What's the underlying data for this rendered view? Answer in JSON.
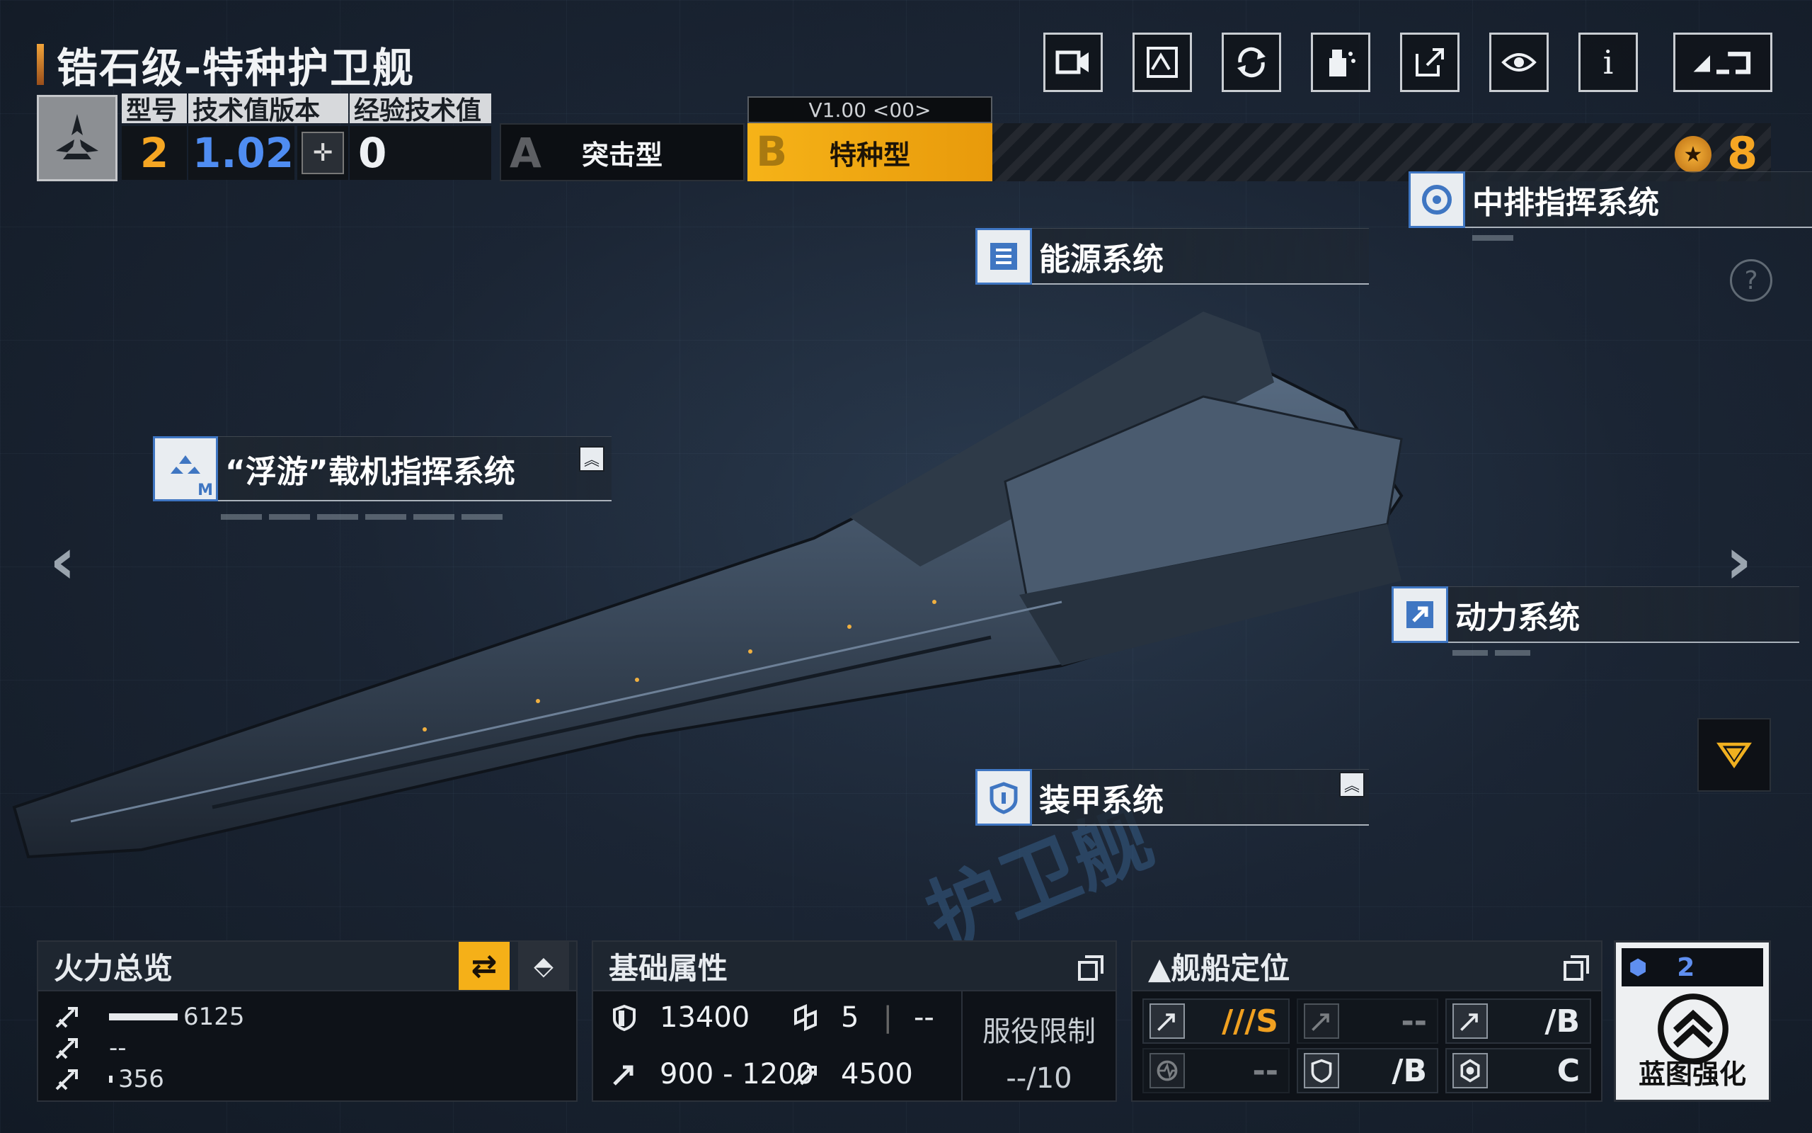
{
  "title": "锆石级-特种护卫舰",
  "stats": {
    "headers": [
      "型号",
      "技术值版本",
      "经验技术值"
    ],
    "model": "2",
    "tech_version": "1.02",
    "exp_tech": "0",
    "divider_symbol": "-|-"
  },
  "type_tabs": [
    {
      "letter": "A",
      "label": "突击型",
      "active": false
    },
    {
      "letter": "B",
      "label": "特种型",
      "active": true
    }
  ],
  "version_label": "V1.00 <00>",
  "rank": "8",
  "systems": {
    "central_command": "中排指挥系统",
    "energy": "能源系统",
    "carrier": "“浮游”载机指挥系统",
    "carrier_badge": "M",
    "power": "动力系统",
    "armor": "装甲系统"
  },
  "watermark": "护卫舰",
  "help": "?",
  "firepower": {
    "title": "火力总览",
    "rows": [
      {
        "icon": "missile-icon",
        "value": "6125",
        "fill": 0.93
      },
      {
        "icon": "missile-icon",
        "value": "--",
        "fill": 0
      },
      {
        "icon": "missile-icon",
        "value": "356",
        "fill": 0.05
      }
    ]
  },
  "attributes": {
    "title": "基础属性",
    "hp": "13400",
    "armor_lvl": "5",
    "armor_extra": "--",
    "speed": "900 - 1200",
    "warp": "4500",
    "service_label": "服役限制",
    "service_value": "--/10"
  },
  "positioning": {
    "title": "▲舰船定位",
    "cells": [
      {
        "icon": "assault-icon",
        "value": "///S"
      },
      {
        "icon": "assault-icon",
        "value": "--"
      },
      {
        "icon": "assault-icon",
        "value": "/B"
      },
      {
        "icon": "heart-icon",
        "value": "--"
      },
      {
        "icon": "shield-icon",
        "value": "/B"
      },
      {
        "icon": "gear-icon",
        "value": "C"
      }
    ]
  },
  "blueprint": {
    "count": "2",
    "label": "蓝图强化"
  }
}
